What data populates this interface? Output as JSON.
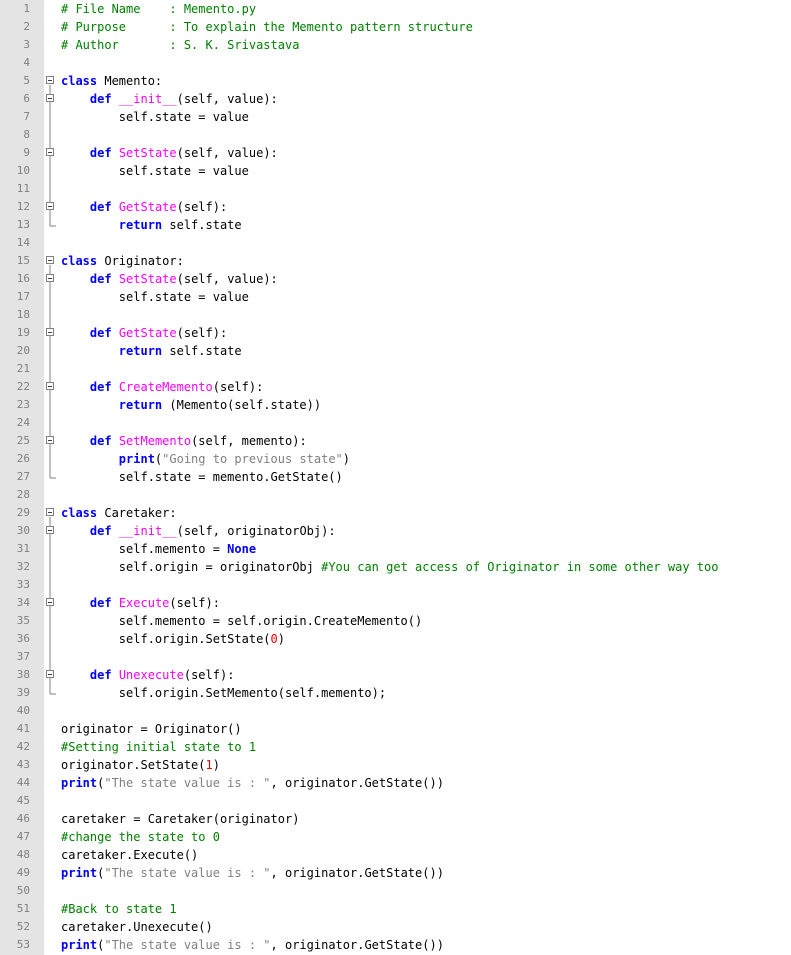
{
  "editor": {
    "lines": [
      [
        {
          "t": "# File Name    : Memento.py",
          "c": "cm"
        }
      ],
      [
        {
          "t": "# Purpose      : To explain the Memento pattern structure",
          "c": "cm"
        }
      ],
      [
        {
          "t": "# Author       : S. K. Srivastava",
          "c": "cm"
        }
      ],
      [],
      [
        {
          "t": "class",
          "c": "kw"
        },
        {
          "t": " Memento:"
        }
      ],
      [
        {
          "t": "    "
        },
        {
          "t": "def",
          "c": "kw"
        },
        {
          "t": " "
        },
        {
          "t": "__init__",
          "c": "fn"
        },
        {
          "t": "(self, value):"
        }
      ],
      [
        {
          "t": "        self.state = value"
        }
      ],
      [],
      [
        {
          "t": "    "
        },
        {
          "t": "def",
          "c": "kw"
        },
        {
          "t": " "
        },
        {
          "t": "SetState",
          "c": "fn"
        },
        {
          "t": "(self, value):"
        }
      ],
      [
        {
          "t": "        self.state = value"
        }
      ],
      [],
      [
        {
          "t": "    "
        },
        {
          "t": "def",
          "c": "kw"
        },
        {
          "t": " "
        },
        {
          "t": "GetState",
          "c": "fn"
        },
        {
          "t": "(self):"
        }
      ],
      [
        {
          "t": "        "
        },
        {
          "t": "return",
          "c": "kw"
        },
        {
          "t": " self.state"
        }
      ],
      [],
      [
        {
          "t": "class",
          "c": "kw"
        },
        {
          "t": " Originator:"
        }
      ],
      [
        {
          "t": "    "
        },
        {
          "t": "def",
          "c": "kw"
        },
        {
          "t": " "
        },
        {
          "t": "SetState",
          "c": "fn"
        },
        {
          "t": "(self, value):"
        }
      ],
      [
        {
          "t": "        self.state = value"
        }
      ],
      [],
      [
        {
          "t": "    "
        },
        {
          "t": "def",
          "c": "kw"
        },
        {
          "t": " "
        },
        {
          "t": "GetState",
          "c": "fn"
        },
        {
          "t": "(self):"
        }
      ],
      [
        {
          "t": "        "
        },
        {
          "t": "return",
          "c": "kw"
        },
        {
          "t": " self.state"
        }
      ],
      [],
      [
        {
          "t": "    "
        },
        {
          "t": "def",
          "c": "kw"
        },
        {
          "t": " "
        },
        {
          "t": "CreateMemento",
          "c": "fn"
        },
        {
          "t": "(self):"
        }
      ],
      [
        {
          "t": "        "
        },
        {
          "t": "return",
          "c": "kw"
        },
        {
          "t": " (Memento(self.state))"
        }
      ],
      [],
      [
        {
          "t": "    "
        },
        {
          "t": "def",
          "c": "kw"
        },
        {
          "t": " "
        },
        {
          "t": "SetMemento",
          "c": "fn"
        },
        {
          "t": "(self, memento):"
        }
      ],
      [
        {
          "t": "        "
        },
        {
          "t": "print",
          "c": "kw"
        },
        {
          "t": "("
        },
        {
          "t": "\"Going to previous state\"",
          "c": "st"
        },
        {
          "t": ")"
        }
      ],
      [
        {
          "t": "        self.state = memento.GetState()"
        }
      ],
      [],
      [
        {
          "t": "class",
          "c": "kw"
        },
        {
          "t": " Caretaker:"
        }
      ],
      [
        {
          "t": "    "
        },
        {
          "t": "def",
          "c": "kw"
        },
        {
          "t": " "
        },
        {
          "t": "__init__",
          "c": "fn"
        },
        {
          "t": "(self, originatorObj):"
        }
      ],
      [
        {
          "t": "        self.memento = "
        },
        {
          "t": "None",
          "c": "kw"
        }
      ],
      [
        {
          "t": "        self.origin = originatorObj "
        },
        {
          "t": "#You can get access of Originator in some other way too",
          "c": "cm"
        }
      ],
      [],
      [
        {
          "t": "    "
        },
        {
          "t": "def",
          "c": "kw"
        },
        {
          "t": " "
        },
        {
          "t": "Execute",
          "c": "fn"
        },
        {
          "t": "(self):"
        }
      ],
      [
        {
          "t": "        self.memento = self.origin.CreateMemento()"
        }
      ],
      [
        {
          "t": "        self.origin.SetState("
        },
        {
          "t": "0",
          "c": "nm"
        },
        {
          "t": ")"
        }
      ],
      [],
      [
        {
          "t": "    "
        },
        {
          "t": "def",
          "c": "kw"
        },
        {
          "t": " "
        },
        {
          "t": "Unexecute",
          "c": "fn"
        },
        {
          "t": "(self):"
        }
      ],
      [
        {
          "t": "        self.origin.SetMemento(self.memento);"
        }
      ],
      [],
      [
        {
          "t": "originator = Originator()"
        }
      ],
      [
        {
          "t": "#Setting initial state to 1",
          "c": "cm"
        }
      ],
      [
        {
          "t": "originator.SetState("
        },
        {
          "t": "1",
          "c": "nm"
        },
        {
          "t": ")"
        }
      ],
      [
        {
          "t": "print",
          "c": "kw"
        },
        {
          "t": "("
        },
        {
          "t": "\"The state value is : \"",
          "c": "st"
        },
        {
          "t": ", originator.GetState())"
        }
      ],
      [],
      [
        {
          "t": "caretaker = Caretaker(originator)"
        }
      ],
      [
        {
          "t": "#change the state to 0",
          "c": "cm"
        }
      ],
      [
        {
          "t": "caretaker.Execute()"
        }
      ],
      [
        {
          "t": "print",
          "c": "kw"
        },
        {
          "t": "("
        },
        {
          "t": "\"The state value is : \"",
          "c": "st"
        },
        {
          "t": ", originator.GetState())"
        }
      ],
      [],
      [
        {
          "t": "#Back to state 1",
          "c": "cm"
        }
      ],
      [
        {
          "t": "caretaker.Unexecute()"
        }
      ],
      [
        {
          "t": "print",
          "c": "kw"
        },
        {
          "t": "("
        },
        {
          "t": "\"The state value is : \"",
          "c": "st"
        },
        {
          "t": ", originator.GetState())"
        }
      ]
    ],
    "fold_lines": [
      5,
      6,
      9,
      12,
      15,
      16,
      19,
      22,
      25,
      29,
      30,
      34,
      38
    ],
    "colors": {
      "keyword": "#0000ff",
      "function_name": "#ff00ff",
      "comment": "#008000",
      "string": "#808080",
      "number": "#ff0000",
      "gutter_bg": "#e4e4e4",
      "line_number": "#808080"
    }
  }
}
